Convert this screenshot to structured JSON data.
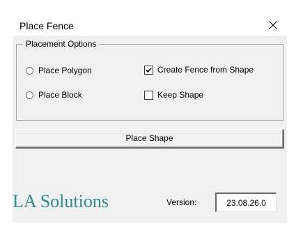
{
  "window": {
    "title": "Place Fence",
    "close_icon": "close-icon"
  },
  "placement_options": {
    "legend": "Placement Options",
    "radios": [
      {
        "label": "Place Polygon",
        "selected": false
      },
      {
        "label": "Place Block",
        "selected": false
      }
    ],
    "checkboxes": [
      {
        "label": "Create Fence from Shape",
        "checked": true
      },
      {
        "label": "Keep Shape",
        "checked": false
      }
    ]
  },
  "actions": {
    "place_shape_label": "Place Shape"
  },
  "footer": {
    "logo_text": "LA Solutions",
    "logo_color": "#2e8c8c",
    "version_label": "Version:",
    "version_value": "23.08.26.0"
  }
}
